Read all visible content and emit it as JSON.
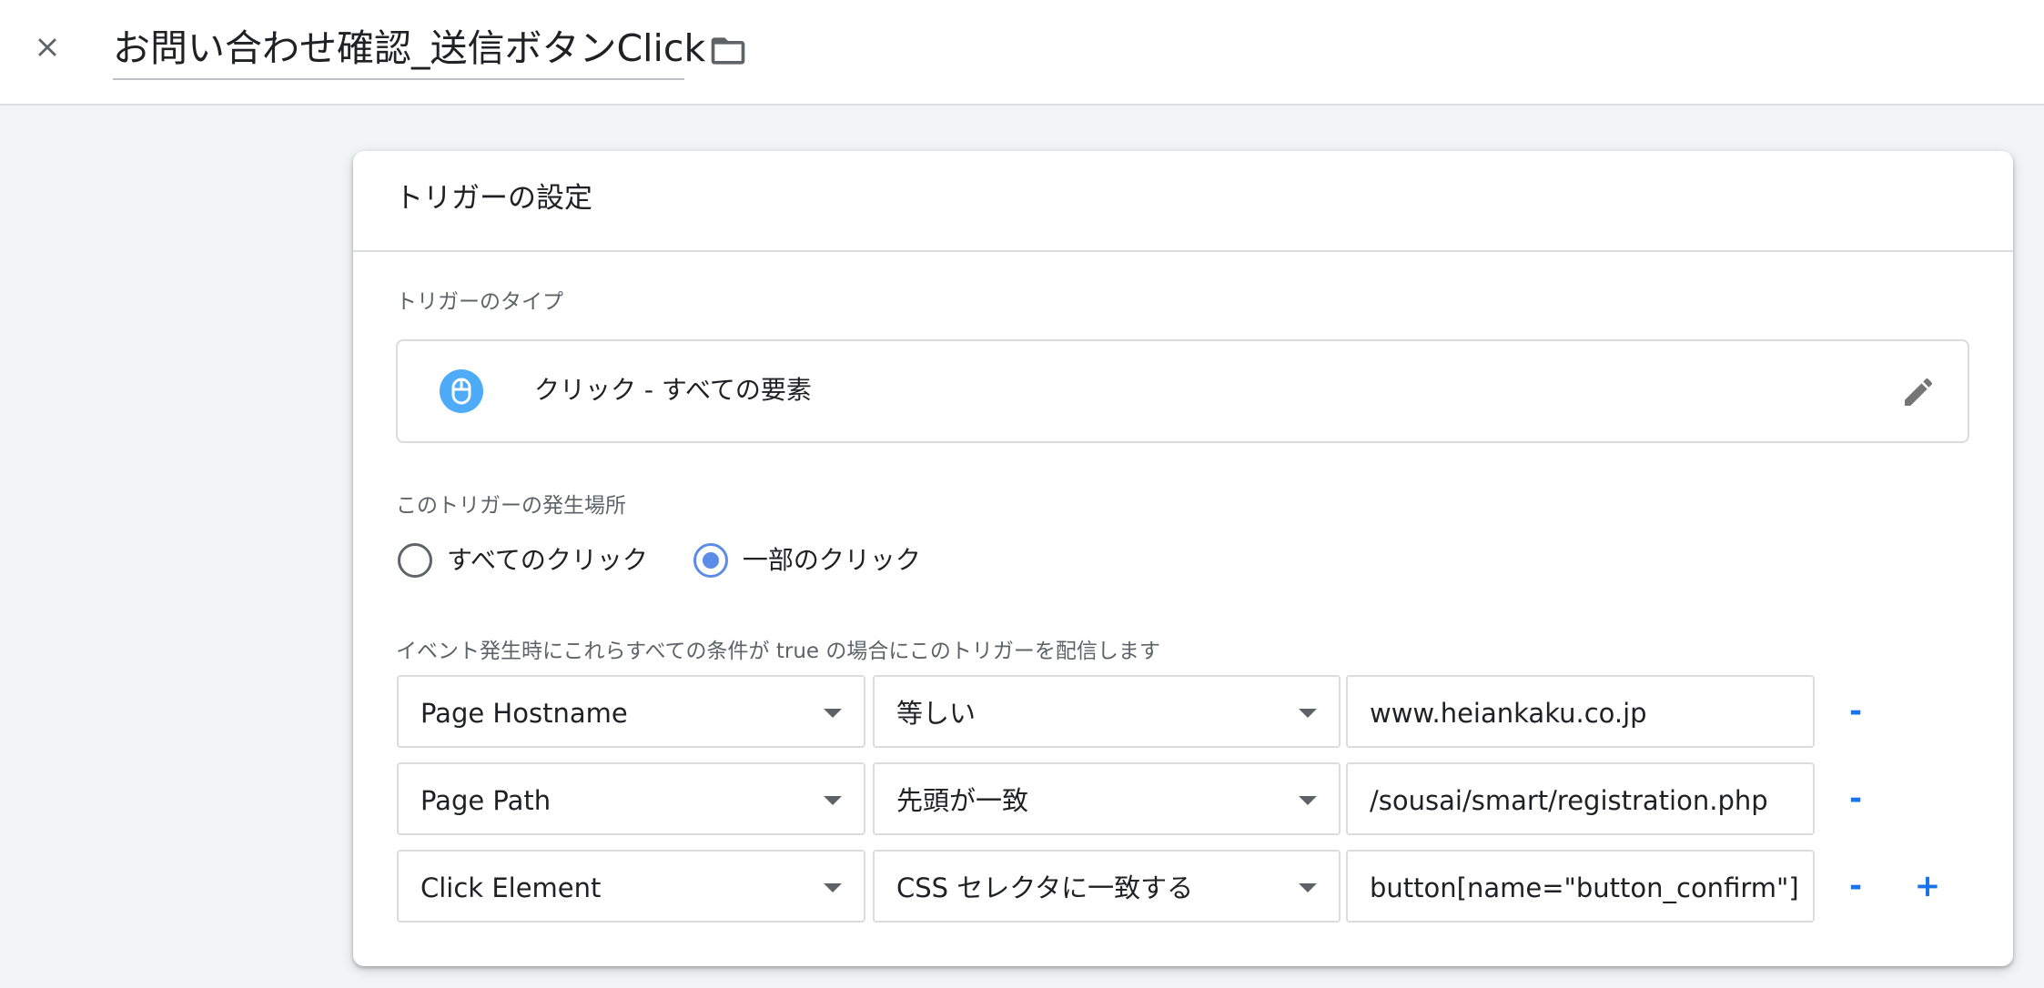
{
  "topbar": {
    "title": "お問い合わせ確認_送信ボタンClick",
    "close_icon": "close-icon",
    "folder_icon": "folder-icon"
  },
  "card": {
    "title": "トリガーの設定",
    "trigger_type_label": "トリガーのタイプ",
    "trigger_type": {
      "icon": "mouse-icon",
      "text": "クリック - すべての要素",
      "edit_icon": "pencil-icon"
    },
    "fire_on_label": "このトリガーの発生場所",
    "fire_on_options": [
      {
        "label": "すべてのクリック",
        "selected": false
      },
      {
        "label": "一部のクリック",
        "selected": true
      }
    ],
    "conditions_label": "イベント発生時にこれらすべての条件が true の場合にこのトリガーを配信します",
    "conditions": [
      {
        "variable": "Page Hostname",
        "operator": "等しい",
        "value": "www.heiankaku.co.jp",
        "remove": "-"
      },
      {
        "variable": "Page Path",
        "operator": "先頭が一致",
        "value": "/sousai/smart/registration.php",
        "remove": "-"
      },
      {
        "variable": "Click Element",
        "operator": "CSS セレクタに一致する",
        "value": "button[name=\"button_confirm\"]",
        "remove": "-",
        "add": "+"
      }
    ]
  },
  "colors": {
    "accent": "#1a73e8",
    "radio_selected": "#5b8ce8",
    "icon_blue": "#4dabf7",
    "background": "#f1f3f4"
  }
}
